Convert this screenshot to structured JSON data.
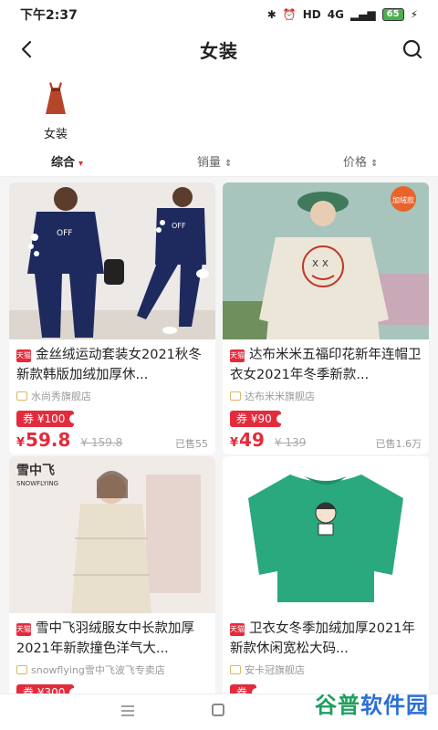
{
  "status": {
    "time": "下午2:37",
    "network": "4G",
    "battery": "65"
  },
  "header": {
    "title": "女装"
  },
  "category": {
    "label": "女装"
  },
  "sort": {
    "items": [
      "综合",
      "销量",
      "价格"
    ]
  },
  "products": [
    {
      "title": "金丝绒运动套装女2021秋冬新款韩版加绒加厚休...",
      "shop": "水尚秀旗舰店",
      "coupon": "券 ¥100",
      "price_symbol": "¥",
      "price": "59.8",
      "original": "¥ 159.8",
      "sold": "已售55",
      "platform": "天猫"
    },
    {
      "title": "达布米米五福印花新年连帽卫衣女2021年冬季新款...",
      "shop": "达布米米旗舰店",
      "coupon": "券 ¥90",
      "price_symbol": "¥",
      "price": "49",
      "original": "¥ 139",
      "sold": "已售1.6万",
      "platform": "天猫",
      "image_tag": "加绒款"
    },
    {
      "title": "雪中飞羽绒服女中长款加厚2021年新款撞色洋气大...",
      "shop": "snowflying雪中飞波飞专卖店",
      "coupon": "券 ¥300",
      "platform": "天猫",
      "brand": "雪中飞",
      "brand_sub": "SNOWFLYING"
    },
    {
      "title": "卫衣女冬季加绒加厚2021年新款休闲宽松大码...",
      "shop": "安卡冠旗舰店",
      "coupon": "券",
      "platform": "天猫"
    }
  ],
  "graphics": {
    "print_text": "OFF"
  },
  "watermark": {
    "part1": "谷普",
    "part2": "软件园"
  },
  "colors": {
    "accent": "#e32b3b",
    "navy": "#1e2a5e",
    "green": "#2aa87e",
    "cream": "#ece6d8"
  }
}
